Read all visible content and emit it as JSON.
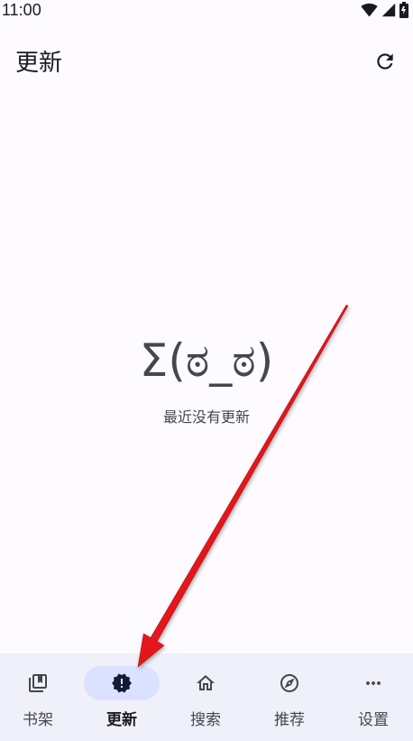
{
  "status_bar": {
    "time": "11:00",
    "icons": [
      "wifi-icon",
      "signal-icon",
      "battery-icon"
    ]
  },
  "app_bar": {
    "title": "更新",
    "actions": [
      {
        "icon": "refresh-icon"
      }
    ]
  },
  "empty_state": {
    "face": "Σ(ಠ_ಠ)",
    "message": "最近没有更新"
  },
  "bottom_nav": {
    "selected_index": 1,
    "items": [
      {
        "label": "书架",
        "icon": "bookshelf-icon"
      },
      {
        "label": "更新",
        "icon": "new-releases-icon"
      },
      {
        "label": "搜索",
        "icon": "home-icon"
      },
      {
        "label": "推荐",
        "icon": "compass-icon"
      },
      {
        "label": "设置",
        "icon": "more-horizontal-icon"
      }
    ]
  },
  "colors": {
    "background": "#fdfbff",
    "nav_background": "#eff0f9",
    "indicator": "#dae2ff",
    "annotation_arrow": "#e4161b"
  }
}
